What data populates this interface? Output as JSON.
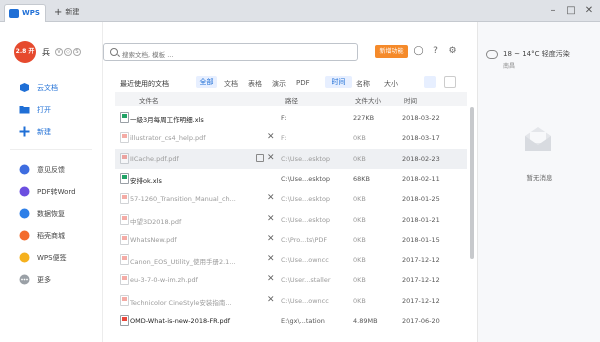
{
  "titlebar": {
    "app_tab": "WPS",
    "new_tab": "新建",
    "controls": [
      "minimize-icon",
      "maximize-icon",
      "close-icon"
    ]
  },
  "user": {
    "avatar_text": "2.8 开抢",
    "name": "兵"
  },
  "sidebar": {
    "items": [
      {
        "label": "云文档",
        "icon": "cloud-doc-icon",
        "color": "#1f6fd6"
      },
      {
        "label": "打开",
        "icon": "folder-icon",
        "color": "#1f6fd6"
      },
      {
        "label": "新建",
        "icon": "plus-icon",
        "color": "#1f6fd6"
      }
    ],
    "tools": [
      {
        "label": "意见反馈",
        "icon": "feedback-icon",
        "color": "#3e6de0"
      },
      {
        "label": "PDF转Word",
        "icon": "pdf-convert-icon",
        "color": "#6c4fe0"
      },
      {
        "label": "数据恢复",
        "icon": "data-recovery-icon",
        "color": "#2e7fe8"
      },
      {
        "label": "稻壳商城",
        "icon": "store-icon",
        "color": "#f36b2c"
      },
      {
        "label": "WPS便签",
        "icon": "note-icon",
        "color": "#f5b11e"
      },
      {
        "label": "更多",
        "icon": "more-icon",
        "color": "#9aa0a6"
      }
    ]
  },
  "search": {
    "placeholder": "搜索文档, 模板 ..."
  },
  "top": {
    "new_feature": "新增功能"
  },
  "filter": {
    "recent_label": "最近使用的文档",
    "all": "全部",
    "types": [
      "文档",
      "表格",
      "演示",
      "PDF"
    ],
    "sync": "时间",
    "name_sort": "名称",
    "size_sort": "大小"
  },
  "table": {
    "headers": {
      "name": "文件名",
      "path": "路径",
      "size": "文件大小",
      "date": "时间"
    },
    "rows": [
      {
        "name": "一級3月每周工作明细.xls",
        "path": "F:",
        "size": "227KB",
        "date": "2018-03-22",
        "type": "xls",
        "dim": false
      },
      {
        "name": "illustrator_cs4_help.pdf",
        "path": "F:",
        "size": "0KB",
        "date": "2018-03-17",
        "type": "pdf",
        "dim": true
      },
      {
        "name": "IICache.pdf.pdf",
        "path": "C:\\Use...esktop",
        "size": "0KB",
        "date": "2018-02-23",
        "type": "pdf",
        "dim": true
      },
      {
        "name": "安排ok.xls",
        "path": "C:\\Use...esktop",
        "size": "68KB",
        "date": "2018-02-11",
        "type": "xls",
        "dim": false
      },
      {
        "name": "57-1260_Transition_Manual_ch...",
        "path": "C:\\Use...esktop",
        "size": "0KB",
        "date": "2018-01-25",
        "type": "pdf",
        "dim": true
      },
      {
        "name": "中望3D2018.pdf",
        "path": "C:\\Use...esktop",
        "size": "0KB",
        "date": "2018-01-21",
        "type": "pdf",
        "dim": true
      },
      {
        "name": "WhatsNew.pdf",
        "path": "C:\\Pro...ts\\PDF",
        "size": "0KB",
        "date": "2018-01-15",
        "type": "pdf",
        "dim": true
      },
      {
        "name": "Canon_EOS_Utility_使用手册2.1...",
        "path": "C:\\Use...owncc",
        "size": "0KB",
        "date": "2017-12-12",
        "type": "pdf",
        "dim": true
      },
      {
        "name": "eu-3-7-0-w-im.zh.pdf",
        "path": "C:\\User...staller",
        "size": "0KB",
        "date": "2017-12-12",
        "type": "pdf",
        "dim": true
      },
      {
        "name": "Technicolor CineStyle安装指南...",
        "path": "C:\\Use...owncc",
        "size": "0KB",
        "date": "2017-12-12",
        "type": "pdf",
        "dim": true
      },
      {
        "name": "OMD-What-is-new-2018-FR.pdf",
        "path": "E:\\gx\\...tation",
        "size": "4.89MB",
        "date": "2017-06-20",
        "type": "pdf",
        "dim": false
      }
    ]
  },
  "right_panel": {
    "weather": "18 ~ 14°C 轻度污染",
    "city": "南昌",
    "no_message": "暂无消息"
  }
}
